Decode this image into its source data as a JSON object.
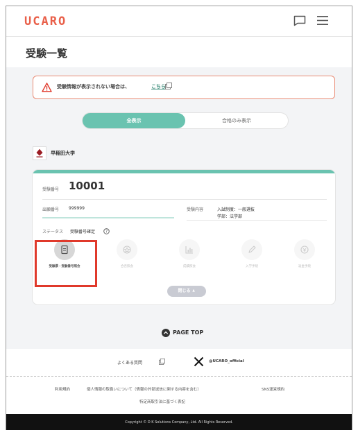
{
  "header": {
    "logo": "UCARO",
    "chat_icon": "chat-bubble-icon",
    "menu_icon": "hamburger-menu-icon"
  },
  "page": {
    "title": "受験一覧"
  },
  "alert": {
    "text": "受験情報が表示されない場合は、",
    "link": "こちら",
    "icon": "warning-icon"
  },
  "filter": {
    "all_label": "全表示",
    "passed_label": "合格のみ表示",
    "selected": "all"
  },
  "university": {
    "name": "早稲田大学"
  },
  "exam": {
    "exam_no_label": "受験番号",
    "exam_no": "10001",
    "application_no_label": "出願番号",
    "application_no": "999999",
    "exam_content_label": "受験内容",
    "exam_content_line1": "入試制度：一般選抜",
    "exam_content_line2": "学部：法学部",
    "status_label": "ステータス",
    "status": "受験番号確定"
  },
  "actions": [
    {
      "label": "受験票・受験番号照会",
      "icon": "document-icon",
      "active": true
    },
    {
      "label": "合否照会",
      "icon": "badge-icon",
      "active": false
    },
    {
      "label": "成績照会",
      "icon": "bar-chart-icon",
      "active": false
    },
    {
      "label": "入学手続",
      "icon": "pencil-icon",
      "active": false
    },
    {
      "label": "返金手続",
      "icon": "refund-icon",
      "active": false
    }
  ],
  "close_button": "閉じる ∧",
  "page_top": "PAGE TOP",
  "footer": {
    "faq": "よくある質問",
    "x_handle": "@UCARO_official",
    "terms": "利用規約",
    "privacy": "個人情報の取扱いについて（情報の外部送信に関する内容を含む）",
    "sns_terms": "SNS運営規約",
    "tokushoho": "特定商取引法に基づく表記",
    "copyright": "Copyright © D K Solutions Company, Ltd. All Rights Reserved."
  },
  "colors": {
    "brand": "#e9604a",
    "accent": "#6ac3b0",
    "highlight": "#e0392b"
  }
}
